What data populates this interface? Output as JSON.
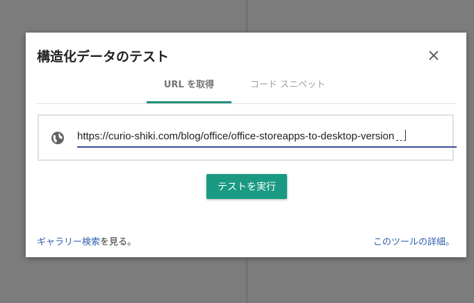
{
  "dialog": {
    "title": "構造化データのテスト",
    "close_label": "×"
  },
  "tabs": [
    {
      "label": "URL を取得",
      "active": true
    },
    {
      "label": "コード スニペット",
      "active": false
    }
  ],
  "url_input": {
    "value": "https://curio-shiki.com/blog/office/office-storeapps-to-desktop-version",
    "icon": "globe-icon"
  },
  "run_button": {
    "label": "テストを実行"
  },
  "footer": {
    "gallery_link": "ギャラリー検索",
    "gallery_suffix": "を見る。",
    "tool_details_link": "このツールの詳細。"
  },
  "colors": {
    "accent": "#1a9a82",
    "link": "#2f5fae",
    "input_underline": "#3c4a95"
  }
}
